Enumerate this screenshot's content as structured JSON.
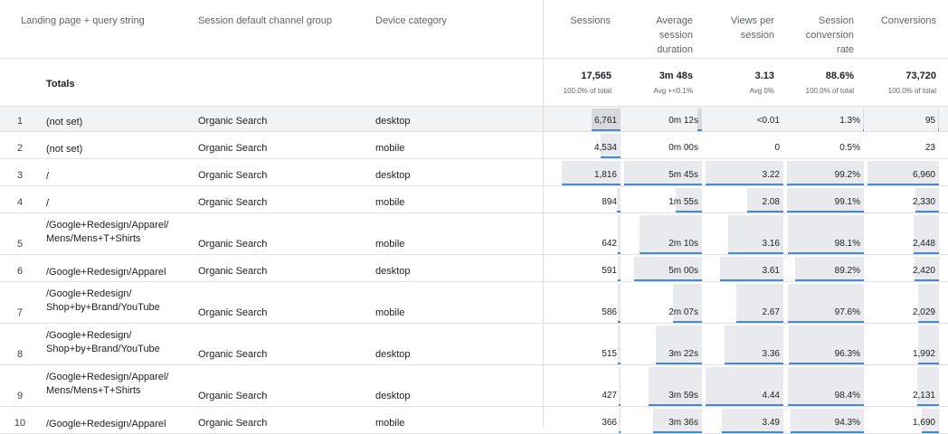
{
  "headers": {
    "landing_page": "Landing page + query string",
    "channel": "Session default channel group",
    "device": "Device category",
    "sessions": [
      "Sessions"
    ],
    "avg_duration": [
      "Average",
      "session",
      "duration"
    ],
    "views_per_session": [
      "Views per",
      "session"
    ],
    "conversion_rate": [
      "Session",
      "conversion",
      "rate"
    ],
    "conversions": [
      "Conversions"
    ]
  },
  "totals": {
    "label": "Totals",
    "sessions": {
      "value": "17,565",
      "sub": "100.0% of total"
    },
    "avg_duration": {
      "value": "3m 48s",
      "sub": "Avg +<0.1%"
    },
    "views_per_session": {
      "value": "3.13",
      "sub": "Avg 0%"
    },
    "conversion_rate": {
      "value": "88.6%",
      "sub": "100.0% of total"
    },
    "conversions": {
      "value": "73,720",
      "sub": "100.0% of total"
    }
  },
  "rows": [
    {
      "n": "1",
      "lp": [
        "(not set)"
      ],
      "ch": "Organic Search",
      "dv": "desktop",
      "sessions": "6,761",
      "dur": "0m 12s",
      "vps": "<0.01",
      "cr": "1.3%",
      "conv": "95",
      "f": {
        "sessions": 0.385,
        "dur": 0.053,
        "vps": 0.001,
        "cr": 0.013,
        "conv": 0.014
      }
    },
    {
      "n": "2",
      "lp": [
        "(not set)"
      ],
      "ch": "Organic Search",
      "dv": "mobile",
      "sessions": "4,534",
      "dur": "0m 00s",
      "vps": "0",
      "cr": "0.5%",
      "conv": "23",
      "f": {
        "sessions": 0.258,
        "dur": 0,
        "vps": 0,
        "cr": 0.005,
        "conv": 0.003
      }
    },
    {
      "n": "3",
      "lp": [
        "/"
      ],
      "ch": "Organic Search",
      "dv": "desktop",
      "sessions": "1,816",
      "dur": "5m 45s",
      "vps": "3.22",
      "cr": "99.2%",
      "conv": "6,960",
      "f": {
        "sessions": 0.77,
        "dur": 1.0,
        "vps": 1.0,
        "cr": 1.0,
        "conv": 1.0
      }
    },
    {
      "n": "4",
      "lp": [
        "/"
      ],
      "ch": "Organic Search",
      "dv": "mobile",
      "sessions": "894",
      "dur": "1m 55s",
      "vps": "2.08",
      "cr": "99.1%",
      "conv": "2,330",
      "f": {
        "sessions": 0.045,
        "dur": 0.34,
        "vps": 0.47,
        "cr": 0.999,
        "conv": 0.335
      }
    },
    {
      "n": "5",
      "lp": [
        "/Google+Redesign/Apparel/",
        "Mens/Mens+T+Shirts"
      ],
      "ch": "Organic Search",
      "dv": "mobile",
      "sessions": "642",
      "dur": "2m 10s",
      "vps": "3.16",
      "cr": "98.1%",
      "conv": "2,448",
      "f": {
        "sessions": 0.035,
        "dur": 0.8,
        "vps": 0.71,
        "cr": 0.989,
        "conv": 0.352
      }
    },
    {
      "n": "6",
      "lp": [
        "/Google+Redesign/Apparel"
      ],
      "ch": "Organic Search",
      "dv": "desktop",
      "sessions": "591",
      "dur": "5m 00s",
      "vps": "3.61",
      "cr": "89.2%",
      "conv": "2,420",
      "f": {
        "sessions": 0.034,
        "dur": 0.87,
        "vps": 0.81,
        "cr": 0.899,
        "conv": 0.348
      }
    },
    {
      "n": "7",
      "lp": [
        "/Google+Redesign/",
        "Shop+by+Brand/YouTube"
      ],
      "ch": "Organic Search",
      "dv": "mobile",
      "sessions": "586",
      "dur": "2m 07s",
      "vps": "2.67",
      "cr": "97.6%",
      "conv": "2,029",
      "f": {
        "sessions": 0.033,
        "dur": 0.37,
        "vps": 0.6,
        "cr": 0.984,
        "conv": 0.292
      }
    },
    {
      "n": "8",
      "lp": [
        "/Google+Redesign/",
        "Shop+by+Brand/YouTube"
      ],
      "ch": "Organic Search",
      "dv": "desktop",
      "sessions": "515",
      "dur": "3m 22s",
      "vps": "3.36",
      "cr": "96.3%",
      "conv": "1,992",
      "f": {
        "sessions": 0.03,
        "dur": 0.59,
        "vps": 0.75,
        "cr": 0.971,
        "conv": 0.286
      }
    },
    {
      "n": "9",
      "lp": [
        "/Google+Redesign/Apparel/",
        "Mens/Mens+T+Shirts"
      ],
      "ch": "Organic Search",
      "dv": "desktop",
      "sessions": "427",
      "dur": "3m 59s",
      "vps": "4.44",
      "cr": "98.4%",
      "conv": "2,131",
      "f": {
        "sessions": 0.024,
        "dur": 0.69,
        "vps": 1.0,
        "cr": 0.992,
        "conv": 0.306
      }
    },
    {
      "n": "10",
      "lp": [
        "/Google+Redesign/Apparel"
      ],
      "ch": "Organic Search",
      "dv": "mobile",
      "sessions": "366",
      "dur": "3m 36s",
      "vps": "3.49",
      "cr": "94.3%",
      "conv": "1,690",
      "f": {
        "sessions": 0.021,
        "dur": 0.63,
        "vps": 0.79,
        "cr": 0.951,
        "conv": 0.243
      }
    }
  ],
  "colors": {
    "accent": "#4285f4",
    "bar": "#e8eaed",
    "border": "#e0e0e0",
    "selected_row": "#f1f3f4"
  }
}
